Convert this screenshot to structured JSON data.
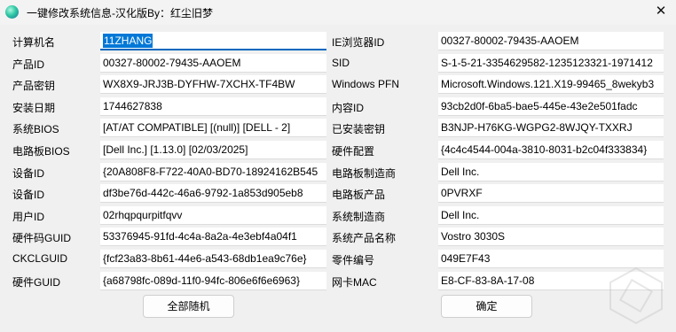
{
  "window": {
    "title": "一键修改系统信息-汉化版By：红尘旧梦",
    "close_glyph": "✕"
  },
  "left_fields": [
    {
      "label": "计算机名",
      "value": "11ZHANG"
    },
    {
      "label": "产品ID",
      "value": "00327-80002-79435-AAOEM"
    },
    {
      "label": "产品密钥",
      "value": "WX8X9-JRJ3B-DYFHW-7XCHX-TF4BW"
    },
    {
      "label": "安装日期",
      "value": "1744627838"
    },
    {
      "label": "系统BIOS",
      "value": "[AT/AT COMPATIBLE] [(null)] [DELL   - 2]"
    },
    {
      "label": "电路板BIOS",
      "value": "[Dell Inc.] [1.13.0] [02/03/2025]"
    },
    {
      "label": "设备ID",
      "value": "{20A808F8-F722-40A0-BD70-18924162B545"
    },
    {
      "label": "设备ID",
      "value": "df3be76d-442c-46a6-9792-1a853d905eb8"
    },
    {
      "label": "用户ID",
      "value": "02rhqpqurpitfqvv"
    },
    {
      "label": "硬件码GUID",
      "value": "53376945-91fd-4c4a-8a2a-4e3ebf4a04f1"
    },
    {
      "label": "CKCLGUID",
      "value": "{fcf23a83-8b61-44e6-a543-68db1ea9c76e}"
    },
    {
      "label": "硬件GUID",
      "value": "{a68798fc-089d-11f0-94fc-806e6f6e6963}"
    }
  ],
  "right_fields": [
    {
      "label": "IE浏览器ID",
      "value": "00327-80002-79435-AAOEM"
    },
    {
      "label": "SID",
      "value": "S-1-5-21-3354629582-1235123321-1971412"
    },
    {
      "label": "Windows PFN",
      "value": "Microsoft.Windows.121.X19-99465_8wekyb3"
    },
    {
      "label": "内容ID",
      "value": "93cb2d0f-6ba5-bae5-445e-43e2e501fadc"
    },
    {
      "label": "已安装密钥",
      "value": "B3NJP-H76KG-WGPG2-8WJQY-TXXRJ"
    },
    {
      "label": "硬件配置",
      "value": "{4c4c4544-004a-3810-8031-b2c04f333834}"
    },
    {
      "label": "电路板制造商",
      "value": "Dell Inc."
    },
    {
      "label": "电路板产品",
      "value": "0PVRXF"
    },
    {
      "label": "系统制造商",
      "value": "Dell Inc."
    },
    {
      "label": "系统产品名称",
      "value": "Vostro 3030S"
    },
    {
      "label": "零件编号",
      "value": "049E7F43"
    },
    {
      "label": "网卡MAC",
      "value": "E8-CF-83-8A-17-08"
    }
  ],
  "buttons": {
    "randomize_all": "全部随机",
    "confirm": "确定"
  }
}
